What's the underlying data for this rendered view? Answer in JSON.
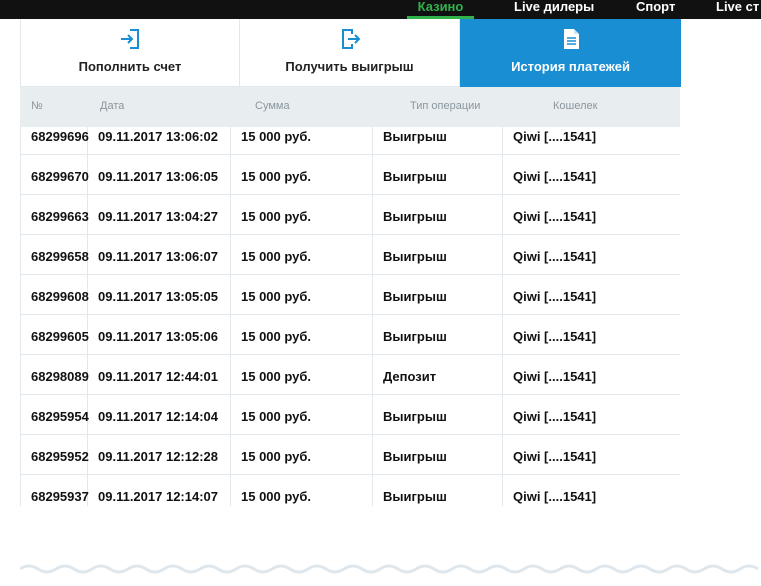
{
  "nav": {
    "items": [
      {
        "label": "Казино",
        "active": true
      },
      {
        "label": "Live дилеры",
        "active": false
      },
      {
        "label": "Спорт",
        "active": false
      },
      {
        "label": "Live ст",
        "active": false
      }
    ]
  },
  "tabs": [
    {
      "label": "Пополнить счет",
      "icon": "deposit-icon",
      "active": false
    },
    {
      "label": "Получить выигрыш",
      "icon": "withdraw-icon",
      "active": false
    },
    {
      "label": "История платежей",
      "icon": "document-icon",
      "active": true
    }
  ],
  "table": {
    "headers": [
      "№",
      "Дата",
      "Сумма",
      "Тип операции",
      "Кошелек"
    ],
    "rows": [
      {
        "id": "68299696",
        "date": "09.11.2017 13:06:02",
        "amount": "15 000 руб.",
        "type": "Выигрыш",
        "wallet": "Qiwi [....1541]"
      },
      {
        "id": "68299670",
        "date": "09.11.2017 13:06:05",
        "amount": "15 000 руб.",
        "type": "Выигрыш",
        "wallet": "Qiwi [....1541]"
      },
      {
        "id": "68299663",
        "date": "09.11.2017 13:04:27",
        "amount": "15 000 руб.",
        "type": "Выигрыш",
        "wallet": "Qiwi [....1541]"
      },
      {
        "id": "68299658",
        "date": "09.11.2017 13:06:07",
        "amount": "15 000 руб.",
        "type": "Выигрыш",
        "wallet": "Qiwi [....1541]"
      },
      {
        "id": "68299608",
        "date": "09.11.2017 13:05:05",
        "amount": "15 000 руб.",
        "type": "Выигрыш",
        "wallet": "Qiwi [....1541]"
      },
      {
        "id": "68299605",
        "date": "09.11.2017 13:05:06",
        "amount": "15 000 руб.",
        "type": "Выигрыш",
        "wallet": "Qiwi [....1541]"
      },
      {
        "id": "68298089",
        "date": "09.11.2017 12:44:01",
        "amount": "15 000 руб.",
        "type": "Депозит",
        "wallet": "Qiwi [....1541]"
      },
      {
        "id": "68295954",
        "date": "09.11.2017 12:14:04",
        "amount": "15 000 руб.",
        "type": "Выигрыш",
        "wallet": "Qiwi [....1541]"
      },
      {
        "id": "68295952",
        "date": "09.11.2017 12:12:28",
        "amount": "15 000 руб.",
        "type": "Выигрыш",
        "wallet": "Qiwi [....1541]"
      },
      {
        "id": "68295937",
        "date": "09.11.2017 12:14:07",
        "amount": "15 000 руб.",
        "type": "Выигрыш",
        "wallet": "Qiwi [....1541]"
      }
    ]
  },
  "colors": {
    "accent": "#1a8ed2",
    "nav_active": "#2fb34a",
    "nav_bg": "#111111",
    "header_bg": "#e8edf0",
    "border": "#e3e8ec"
  }
}
